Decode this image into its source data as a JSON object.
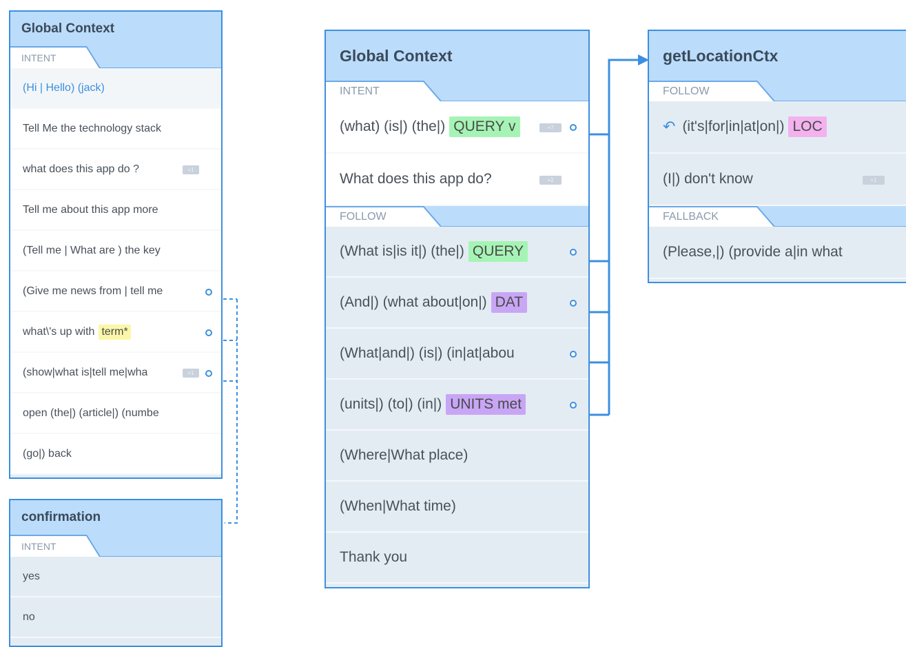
{
  "left_global": {
    "title": "Global Context",
    "section_intent": "INTENT",
    "rows": [
      "(Hi | Hello) (jack)",
      "Tell Me the technology stack",
      "what does this app do ?",
      "Tell me about this app more",
      "(Tell me | What are ) the key",
      "(Give me news from | tell me",
      "what\\'s up with",
      "(show|what is|tell me|wha",
      "open (the|) (article|) (numbe",
      "(go|) back"
    ],
    "chip_term": "term*",
    "badge_row3": "+1",
    "badge_row8": "+1"
  },
  "confirmation": {
    "title": "confirmation",
    "section_intent": "INTENT",
    "rows": [
      "yes",
      "no"
    ]
  },
  "main_global": {
    "title": "Global Context",
    "section_intent": "INTENT",
    "section_follow": "FOLLOW",
    "intent_rows": [
      {
        "text": "(what) (is|) (the|)",
        "chip": "QUERY v",
        "chip_color": "green",
        "badge": "+7"
      },
      {
        "text": "What does this app do?",
        "badge": "+2"
      }
    ],
    "follow_rows": [
      {
        "text": "(What is|is it|) (the|)",
        "chip": "QUERY",
        "chip_color": "green"
      },
      {
        "text": "(And|) (what about|on|)",
        "chip": "DAT",
        "chip_color": "purple"
      },
      {
        "text": "(What|and|) (is|) (in|at|abou"
      },
      {
        "text": "(units|) (to|) (in|)",
        "chip": "UNITS met",
        "chip_color": "purple"
      },
      {
        "text": "(Where|What place)"
      },
      {
        "text": "(When|What time)"
      },
      {
        "text": "Thank you"
      }
    ]
  },
  "location_ctx": {
    "title": "getLocationCtx",
    "section_follow": "FOLLOW",
    "section_fallback": "FALLBACK",
    "follow_rows": [
      {
        "text": "(it's|for|in|at|on|)",
        "chip": "LOC",
        "chip_color": "pink",
        "icon": "return-arrow-icon"
      },
      {
        "text": "(I|) don't know",
        "badge": "+1"
      }
    ],
    "fallback_rows": [
      {
        "text": "(Please,|) (provide a|in what"
      }
    ]
  },
  "colors": {
    "accent": "#3b8fe0",
    "header_bg": "#bcdcfb",
    "body_bg": "#e4ecf3",
    "chip_green": "#a6f4b5",
    "chip_purple": "#c8a6f5",
    "chip_pink": "#f3b2ee",
    "chip_yellow": "#fbf7a9"
  }
}
